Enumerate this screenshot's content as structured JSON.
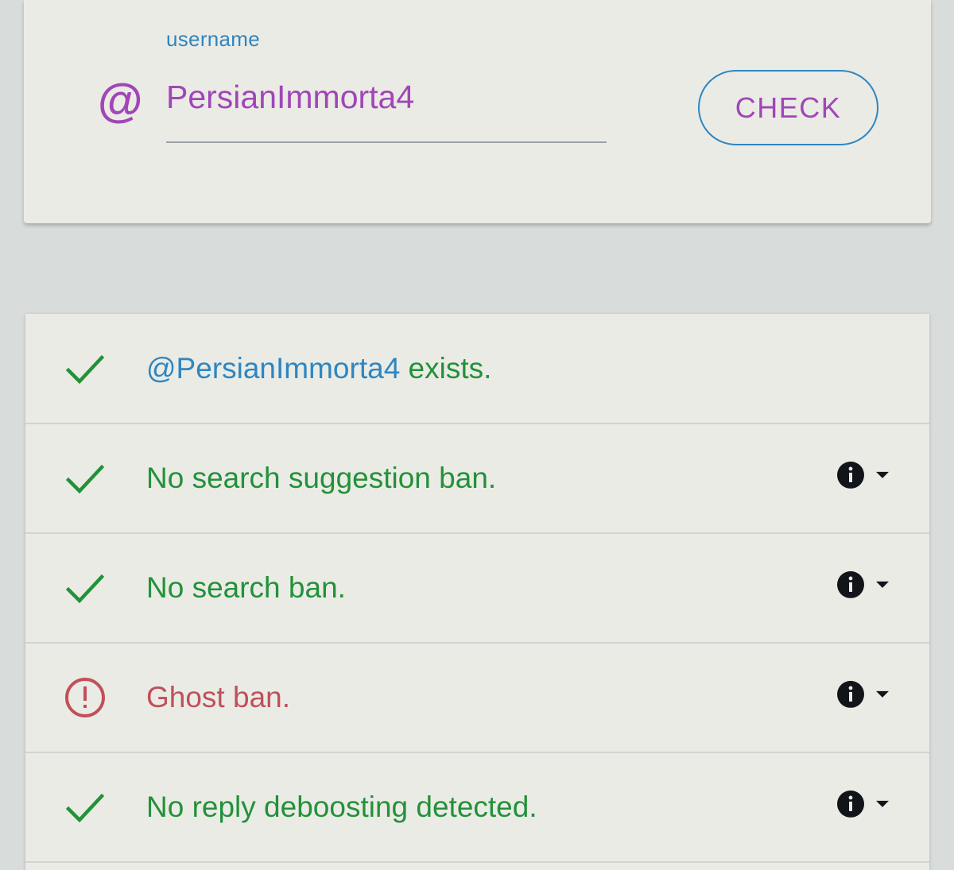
{
  "form": {
    "label": "username",
    "at_symbol": "@",
    "username_value": "PersianImmorta4",
    "check_label": "CHECK"
  },
  "results": [
    {
      "status": "ok",
      "mention": "@PersianImmorta4",
      "text": " exists.",
      "has_details": false
    },
    {
      "status": "ok",
      "text": "No search suggestion ban.",
      "has_details": true
    },
    {
      "status": "ok",
      "text": "No search ban.",
      "has_details": true
    },
    {
      "status": "warning",
      "text": "Ghost ban.",
      "has_details": true
    },
    {
      "status": "ok",
      "text": "No reply deboosting detected.",
      "has_details": true
    }
  ],
  "icons": {
    "ok": "check-icon",
    "warning": "alert-circle-icon",
    "info": "info-icon",
    "expand": "caret-down-icon"
  },
  "colors": {
    "ok": "#22913a",
    "warning": "#c0505a",
    "accent": "#2e86c1",
    "brand": "#a146b8"
  }
}
